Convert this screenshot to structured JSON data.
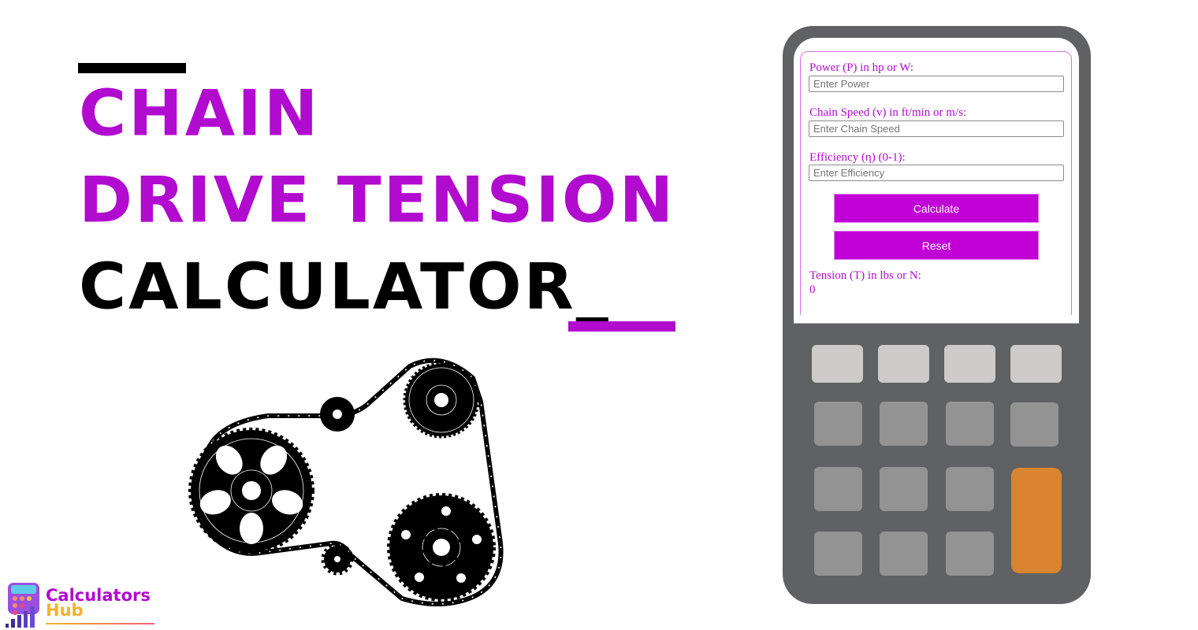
{
  "hero": {
    "title_line1": "CHAIN",
    "title_line2": "DRIVE TENSION",
    "title_line3": "CALCULATOR_",
    "accent_color": "#b10bcf"
  },
  "illustration": {
    "name": "chain-drive-sprockets"
  },
  "logo": {
    "line1": "Calculators",
    "line2": "Hub"
  },
  "calculator": {
    "fields": [
      {
        "label": "Power (P) in hp or W:",
        "placeholder": "Enter Power",
        "value": ""
      },
      {
        "label": "Chain Speed (v) in ft/min or m/s:",
        "placeholder": "Enter Chain Speed",
        "value": ""
      },
      {
        "label": "Efficiency (η) (0-1):",
        "placeholder": "Enter Efficiency",
        "value": ""
      }
    ],
    "calculate_label": "Calculate",
    "reset_label": "Reset",
    "result_label": "Tension (T) in lbs or N:",
    "result_value": "0",
    "button_color": "#c000d6"
  },
  "keypad": {
    "rows": 4,
    "cols": 4,
    "orange_key_color": "#d98430"
  }
}
